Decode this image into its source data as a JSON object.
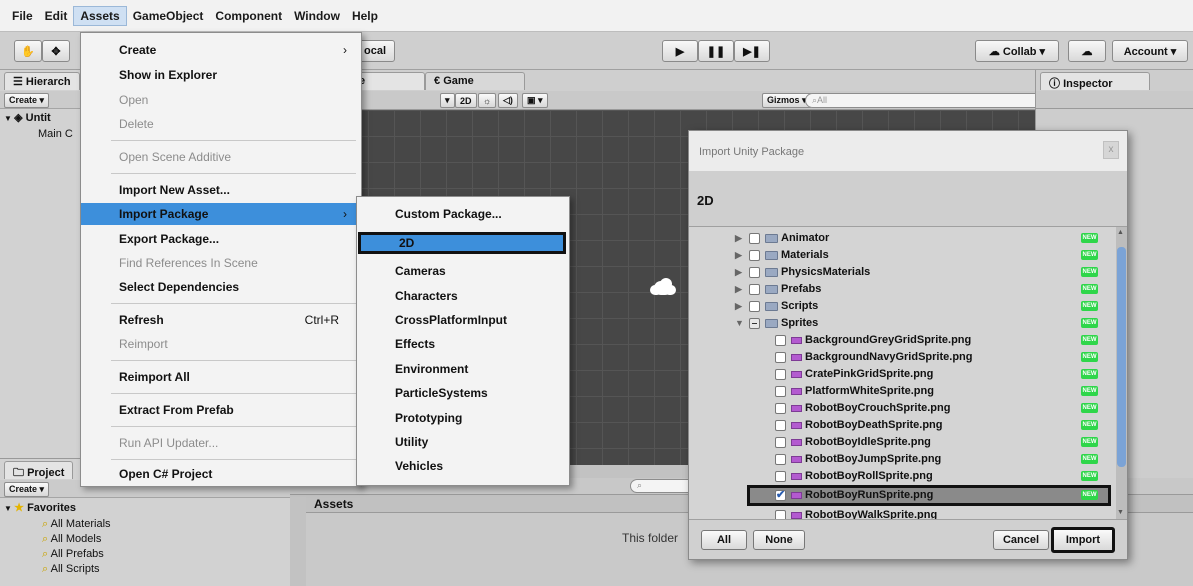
{
  "menubar": {
    "items": [
      "File",
      "Edit",
      "Assets",
      "GameObject",
      "Component",
      "Window",
      "Help"
    ]
  },
  "toolbar": {
    "local_label": "ocal",
    "collab_label": "Collab ▾",
    "account_label": "Account ▾"
  },
  "hierarchy": {
    "tab_label": "Hierarch",
    "create_label": "Create ▾",
    "scene_name": "Untit",
    "camera_name": "Main C"
  },
  "scene_view": {
    "scene_tab": "e",
    "game_tab": "Game",
    "mode_2d": "2D",
    "gizmos_label": "Gizmos ▾",
    "search_placeholder": "All"
  },
  "inspector": {
    "tab_label": "Inspector"
  },
  "assets_menu": {
    "items": [
      {
        "label": "Create",
        "arrow": "›"
      },
      {
        "label": "Show in Explorer"
      },
      {
        "label": "Open",
        "disabled": true
      },
      {
        "label": "Delete",
        "disabled": true
      },
      {
        "label": "Open Scene Additive",
        "disabled": true
      },
      {
        "label": "Import New Asset..."
      },
      {
        "label": "Import Package",
        "arrow": "›"
      },
      {
        "label": "Export Package..."
      },
      {
        "label": "Find References In Scene",
        "disabled": true
      },
      {
        "label": "Select Dependencies"
      },
      {
        "label": "Refresh",
        "shortcut": "Ctrl+R"
      },
      {
        "label": "Reimport",
        "disabled": true
      },
      {
        "label": "Reimport All"
      },
      {
        "label": "Extract From Prefab"
      },
      {
        "label": "Run API Updater...",
        "disabled": true
      },
      {
        "label": "Open C# Project"
      }
    ]
  },
  "import_submenu": {
    "items": [
      "Custom Package...",
      "2D",
      "Cameras",
      "Characters",
      "CrossPlatformInput",
      "Effects",
      "Environment",
      "ParticleSystems",
      "Prototyping",
      "Utility",
      "Vehicles"
    ]
  },
  "dialog": {
    "title": "Import Unity Package",
    "close": "x",
    "header": "2D",
    "new_badge": "NEW",
    "folders": [
      "Animator",
      "Materials",
      "PhysicsMaterials",
      "Prefabs",
      "Scripts",
      "Sprites"
    ],
    "files": [
      "BackgroundGreyGridSprite.png",
      "BackgroundNavyGridSprite.png",
      "CratePinkGridSprite.png",
      "PlatformWhiteSprite.png",
      "RobotBoyCrouchSprite.png",
      "RobotBoyDeathSprite.png",
      "RobotBoyIdleSprite.png",
      "RobotBoyJumpSprite.png",
      "RobotBoyRollSprite.png",
      "RobotBoyRunSprite.png",
      "RobotBoyWalkSprite.png"
    ],
    "checked_file": "RobotBoyRunSprite.png",
    "buttons": {
      "all": "All",
      "none": "None",
      "cancel": "Cancel",
      "import": "Import"
    }
  },
  "project": {
    "tab_label": "Project",
    "create_label": "Create ▾",
    "favorites_label": "Favorites",
    "favorites": [
      "All Materials",
      "All Models",
      "All Prefabs",
      "All Scripts"
    ],
    "assets_header": "Assets",
    "empty_message": "This folder"
  },
  "colors": {
    "highlight": "#3d8fdb",
    "new_badge": "#2fd64a",
    "scene_bg": "#474747"
  }
}
